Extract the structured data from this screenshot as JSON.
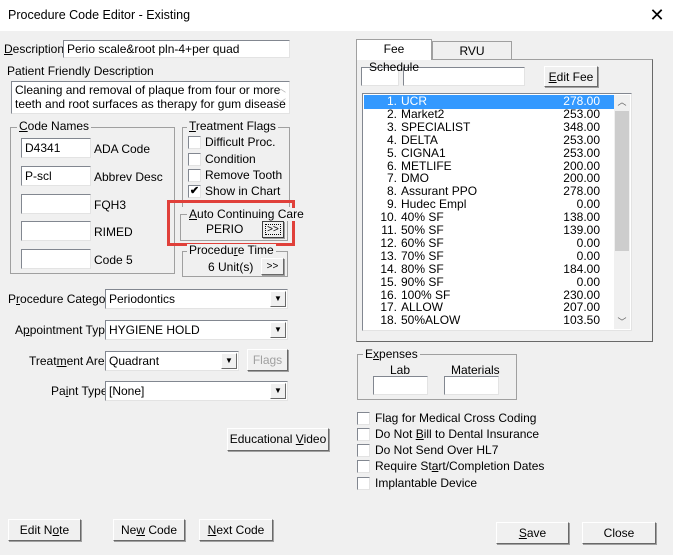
{
  "window": {
    "title": "Procedure Code Editor - Existing",
    "close_icon": "close-icon"
  },
  "description": {
    "label": "Description:",
    "value": "Perio scale&root pln-4+per quad"
  },
  "patient_friendly": {
    "label": "Patient Friendly Description",
    "value_line1": "Cleaning and removal of plaque from four or more",
    "value_line2": "teeth and root surfaces as therapy for gum disease"
  },
  "code_names": {
    "title": "Code Names",
    "fields": [
      {
        "value": "D4341",
        "label": "ADA Code"
      },
      {
        "value": "P-scl",
        "label": "Abbrev Desc"
      },
      {
        "value": "",
        "label": "FQH3"
      },
      {
        "value": "",
        "label": "RIMED"
      },
      {
        "value": "",
        "label": "Code 5"
      }
    ]
  },
  "treatment_flags": {
    "title": "Treatment Flags",
    "items": [
      {
        "label": "Difficult Proc.",
        "checked": false,
        "mark": ""
      },
      {
        "label": "Condition",
        "checked": false,
        "mark": ""
      },
      {
        "label": "Remove Tooth",
        "checked": false,
        "mark": ""
      },
      {
        "label": "Show in Chart",
        "checked": true,
        "mark": "✔"
      }
    ]
  },
  "auto_continuing_care": {
    "title": "Auto Continuing Care",
    "value": "PERIO",
    "button_label": ">>"
  },
  "procedure_time": {
    "title": "Procedure Time",
    "value": "6  Unit(s)",
    "button_label": ">>"
  },
  "procedure_category": {
    "label": "Procedure Category:",
    "value": "Periodontics"
  },
  "appointment_type": {
    "label": "Appointment Type:",
    "value": "HYGIENE HOLD"
  },
  "treatment_area": {
    "label": "Treatment Area:",
    "value": "Quadrant",
    "flags_button": "Flags"
  },
  "paint_type": {
    "label": "Paint Type:",
    "value": "[None]"
  },
  "educational_video_button": "Educational Video",
  "tabs": [
    {
      "label": "Fee Schedule",
      "active": true
    },
    {
      "label": "RVU Schedule",
      "active": false
    }
  ],
  "fee_schedule": {
    "input1": "",
    "input2": "",
    "edit_fee_button": "Edit Fee",
    "selected_index": 0,
    "rows": [
      {
        "num": "1.",
        "name": "UCR",
        "fee": "278.00"
      },
      {
        "num": "2.",
        "name": "Market2",
        "fee": "253.00"
      },
      {
        "num": "3.",
        "name": "SPECIALIST",
        "fee": "348.00"
      },
      {
        "num": "4.",
        "name": "DELTA",
        "fee": "253.00"
      },
      {
        "num": "5.",
        "name": "CIGNA1",
        "fee": "253.00"
      },
      {
        "num": "6.",
        "name": "METLIFE",
        "fee": "200.00"
      },
      {
        "num": "7.",
        "name": "DMO",
        "fee": "200.00"
      },
      {
        "num": "8.",
        "name": "Assurant PPO",
        "fee": "278.00"
      },
      {
        "num": "9.",
        "name": "Hudec Empl",
        "fee": "0.00"
      },
      {
        "num": "10.",
        "name": "40% SF",
        "fee": "138.00"
      },
      {
        "num": "11.",
        "name": "50% SF",
        "fee": "139.00"
      },
      {
        "num": "12.",
        "name": "60% SF",
        "fee": "0.00"
      },
      {
        "num": "13.",
        "name": "70% SF",
        "fee": "0.00"
      },
      {
        "num": "14.",
        "name": "80% SF",
        "fee": "184.00"
      },
      {
        "num": "15.",
        "name": "90% SF",
        "fee": "0.00"
      },
      {
        "num": "16.",
        "name": "100% SF",
        "fee": "230.00"
      },
      {
        "num": "17.",
        "name": "ALLOW",
        "fee": "207.00"
      },
      {
        "num": "18.",
        "name": "50%ALOW",
        "fee": "103.50"
      }
    ]
  },
  "expenses": {
    "title": "Expenses",
    "lab_label": "Lab",
    "lab_value": "",
    "materials_label": "Materials",
    "materials_value": ""
  },
  "options": [
    {
      "label": "Flag for Medical Cross Coding",
      "checked": false
    },
    {
      "label": "Do Not Bill to Dental Insurance",
      "checked": false
    },
    {
      "label": "Do Not Send Over HL7",
      "checked": false
    },
    {
      "label": "Require Start/Completion Dates",
      "checked": false
    },
    {
      "label": "Implantable Device",
      "checked": false
    }
  ],
  "buttons": {
    "edit_note": "Edit Note",
    "new_code": "New Code",
    "next_code": "Next Code",
    "save": "Save",
    "close": "Close"
  },
  "colors": {
    "selection": "#3399ff",
    "highlight_box": "#e0403a"
  }
}
